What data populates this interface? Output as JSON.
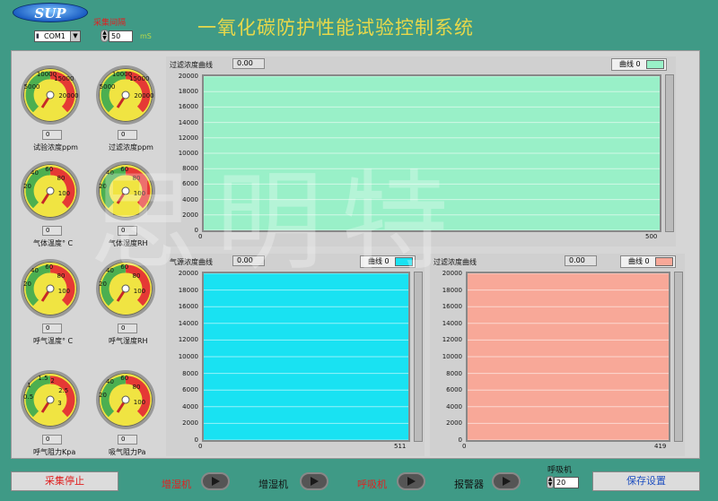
{
  "header": {
    "logo": "SUP",
    "port": {
      "value": "COM1",
      "prefix": "I/O"
    },
    "interval": {
      "label": "采集间隔",
      "value": "50",
      "unit": "mS"
    },
    "title": "一氧化碳防护性能试验控制系统"
  },
  "gauges": [
    {
      "name": "试验浓度ppm",
      "value": "0",
      "ticks": [
        "5000",
        "10000",
        "15000",
        "20000"
      ]
    },
    {
      "name": "过滤浓度ppm",
      "value": "0",
      "ticks": [
        "5000",
        "10000",
        "15000",
        "20000"
      ]
    },
    {
      "name": "气体温度° C",
      "value": "0",
      "ticks": [
        "20",
        "40",
        "60",
        "80",
        "100"
      ]
    },
    {
      "name": "气体湿度RH",
      "value": "0",
      "ticks": [
        "20",
        "40",
        "60",
        "80",
        "100"
      ]
    },
    {
      "name": "呼气温度° C",
      "value": "0",
      "ticks": [
        "20",
        "40",
        "60",
        "80",
        "100"
      ]
    },
    {
      "name": "呼气湿度RH",
      "value": "0",
      "ticks": [
        "20",
        "40",
        "60",
        "80",
        "100"
      ]
    },
    {
      "name": "呼气阻力Kpa",
      "value": "0",
      "ticks": [
        "0.5",
        "1",
        "1.5",
        "2",
        "2.5",
        "3"
      ]
    },
    {
      "name": "吸气阻力Pa",
      "value": "0",
      "ticks": [
        "20",
        "40",
        "60",
        "80",
        "100"
      ]
    }
  ],
  "charts": [
    {
      "title": "过滤浓度曲线",
      "value": "0.00",
      "legend": "曲线 0",
      "color": "#99f0c8",
      "yticks": [
        "20000",
        "18000",
        "16000",
        "14000",
        "12000",
        "10000",
        "8000",
        "6000",
        "4000",
        "2000",
        "0"
      ],
      "xmin": "0",
      "xmax": "500"
    },
    {
      "title": "气源浓度曲线",
      "value": "0.00",
      "legend": "曲线 0",
      "color": "#19e2f2",
      "yticks": [
        "20000",
        "18000",
        "16000",
        "14000",
        "12000",
        "10000",
        "8000",
        "6000",
        "4000",
        "2000",
        "0"
      ],
      "xmin": "0",
      "xmax": "511"
    },
    {
      "title": "过滤浓度曲线",
      "value": "0.00",
      "legend": "曲线 0",
      "color": "#f8a898",
      "yticks": [
        "20000",
        "18000",
        "16000",
        "14000",
        "12000",
        "10000",
        "8000",
        "6000",
        "4000",
        "2000",
        "0"
      ],
      "xmin": "0",
      "xmax": "419"
    }
  ],
  "chart_data": [
    {
      "type": "line",
      "title": "过滤浓度曲线",
      "ylim": [
        0,
        20000
      ],
      "x": [
        0,
        500
      ],
      "series": [
        {
          "values": []
        }
      ]
    },
    {
      "type": "line",
      "title": "气源浓度曲线",
      "ylim": [
        0,
        20000
      ],
      "x": [
        0,
        511
      ],
      "series": [
        {
          "values": []
        }
      ]
    },
    {
      "type": "line",
      "title": "过滤浓度曲线",
      "ylim": [
        0,
        20000
      ],
      "x": [
        0,
        419
      ],
      "series": [
        {
          "values": []
        }
      ]
    }
  ],
  "bottom": {
    "stop": "采集停止",
    "humidifier1": "增湿机",
    "humidifier2": "增湿机",
    "breather": "呼吸机",
    "alarm": "报警器",
    "breather_rate_label": "呼吸机",
    "breather_rate": "20",
    "save": "保存设置"
  },
  "watermark": "思明特"
}
